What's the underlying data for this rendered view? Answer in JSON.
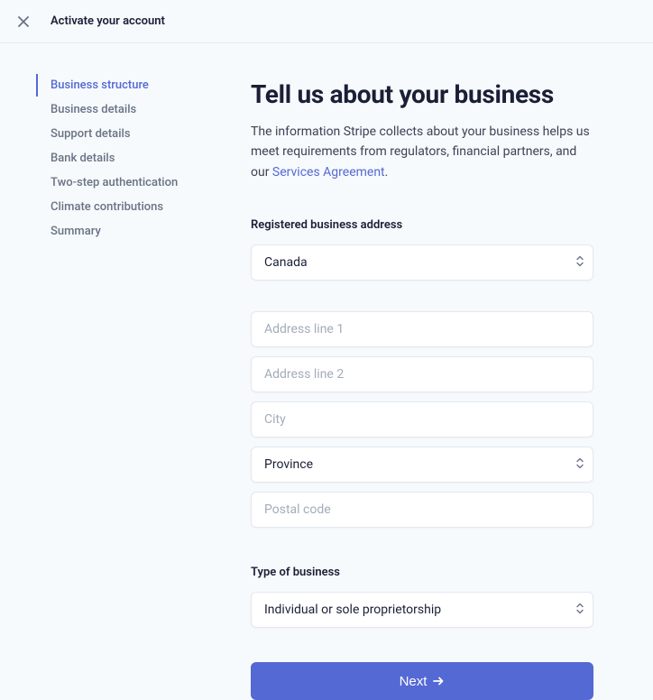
{
  "header": {
    "title": "Activate your account"
  },
  "sidebar": {
    "items": [
      {
        "label": "Business structure",
        "active": true
      },
      {
        "label": "Business details",
        "active": false
      },
      {
        "label": "Support details",
        "active": false
      },
      {
        "label": "Bank details",
        "active": false
      },
      {
        "label": "Two-step authentication",
        "active": false
      },
      {
        "label": "Climate contributions",
        "active": false
      },
      {
        "label": "Summary",
        "active": false
      }
    ]
  },
  "main": {
    "title": "Tell us about your business",
    "description_prefix": "The information Stripe collects about your business helps us meet requirements from regulators, financial partners, and our ",
    "description_link": "Services Agreement",
    "description_suffix": ".",
    "address_section_label": "Registered business address",
    "country_value": "Canada",
    "address1_placeholder": "Address line 1",
    "address2_placeholder": "Address line 2",
    "city_placeholder": "City",
    "province_value": "Province",
    "postal_placeholder": "Postal code",
    "type_section_label": "Type of business",
    "business_type_value": "Individual or sole proprietorship",
    "next_label": "Next"
  }
}
